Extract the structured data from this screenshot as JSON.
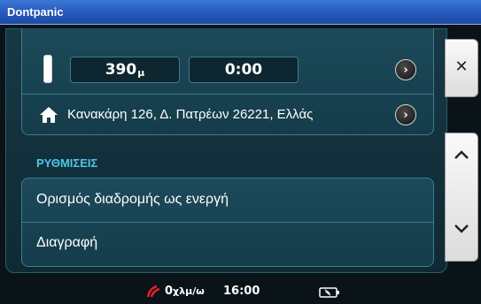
{
  "window": {
    "title": "Dontpanic"
  },
  "trip": {
    "distance_value": "390",
    "distance_unit": "μ",
    "time": "0:00"
  },
  "destination": {
    "address": "Κανακάρη 126, Δ. Πατρέων 26221, Ελλάς",
    "icon": "home-icon"
  },
  "settings": {
    "section_title": "ΡΥΘΜΙΣΕΙΣ",
    "items": [
      {
        "label": "Ορισμός διαδρομής ως ενεργή"
      },
      {
        "label": "Διαγραφή"
      }
    ]
  },
  "side_buttons": {
    "close_glyph": "✕",
    "up_glyph": "︿",
    "down_glyph": "﹀"
  },
  "statusbar": {
    "speed_value": "0",
    "speed_unit": "χλμ/ω",
    "clock": "16:00"
  },
  "colors": {
    "accent": "#4fc6e8",
    "titlebar": "#2457b8",
    "panel": "#163845",
    "speed_icon": "#e0202a"
  }
}
